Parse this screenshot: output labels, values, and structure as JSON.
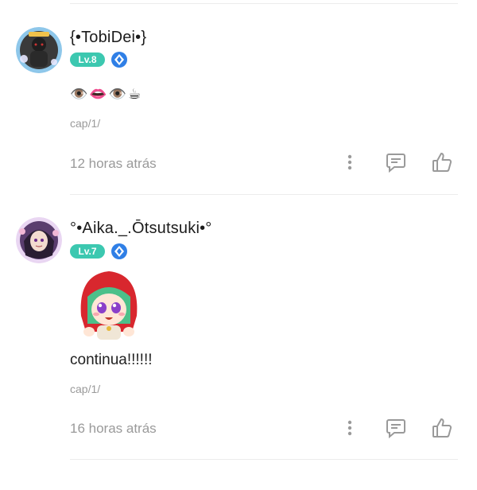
{
  "comments": [
    {
      "username": "{•TobiDei•}",
      "level": "Lv.8",
      "content": "👁️👄👁️☕",
      "reference": "cap/1/",
      "time": "12 horas atrás"
    },
    {
      "username": "°•Aika._.Ōtsutsuki•°",
      "level": "Lv.7",
      "content": "continua!!!!!!",
      "reference": "cap/1/",
      "time": "16 horas atrás"
    }
  ],
  "icons": {
    "more": "more-vertical-icon",
    "reply": "reply-bubble-icon",
    "like": "thumbs-up-icon",
    "gem": "gem-icon"
  },
  "colors": {
    "level_badge": "#3cc8b0",
    "gem": "#2f7fe6",
    "muted_text": "#9a9a9a",
    "icon_gray": "#9a9a9a"
  }
}
